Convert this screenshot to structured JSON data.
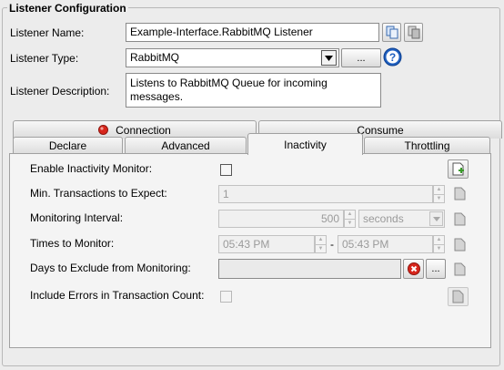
{
  "group_title": "Listener Configuration",
  "listener": {
    "name_label": "Listener Name:",
    "name_value": "Example-Interface.RabbitMQ Listener",
    "type_label": "Listener Type:",
    "type_value": "RabbitMQ",
    "type_browse_label": "...",
    "description_label": "Listener Description:",
    "description_value": "Listens to RabbitMQ Queue for incoming messages."
  },
  "tabs": {
    "row1": [
      {
        "label": "Connection",
        "status": "error"
      },
      {
        "label": "Consume"
      }
    ],
    "row2": [
      {
        "label": "Declare"
      },
      {
        "label": "Advanced"
      },
      {
        "label": "Inactivity",
        "active": true
      },
      {
        "label": "Throttling"
      }
    ]
  },
  "inactivity": {
    "enable_label": "Enable Inactivity Monitor:",
    "enable_checked": false,
    "min_tx_label": "Min. Transactions to Expect:",
    "min_tx_value": "1",
    "interval_label": "Monitoring Interval:",
    "interval_value": "500",
    "interval_unit": "seconds",
    "times_label": "Times to Monitor:",
    "time_from": "05:43 PM",
    "time_separator": "-",
    "time_to": "05:43 PM",
    "days_label": "Days to Exclude from Monitoring:",
    "days_value": "",
    "days_browse_label": "...",
    "include_errors_label": "Include Errors in Transaction Count:",
    "include_errors_checked": false
  },
  "icons": {
    "copy": "copy-icon",
    "paste": "paste-icon",
    "help": "help-icon",
    "error": "error-status-icon",
    "add_note": "add-note-icon",
    "note": "note-icon",
    "clear": "clear-icon"
  },
  "colors": {
    "help_blue": "#1f5fbf",
    "error_red": "#d8261c",
    "add_green": "#3a9a2a"
  }
}
